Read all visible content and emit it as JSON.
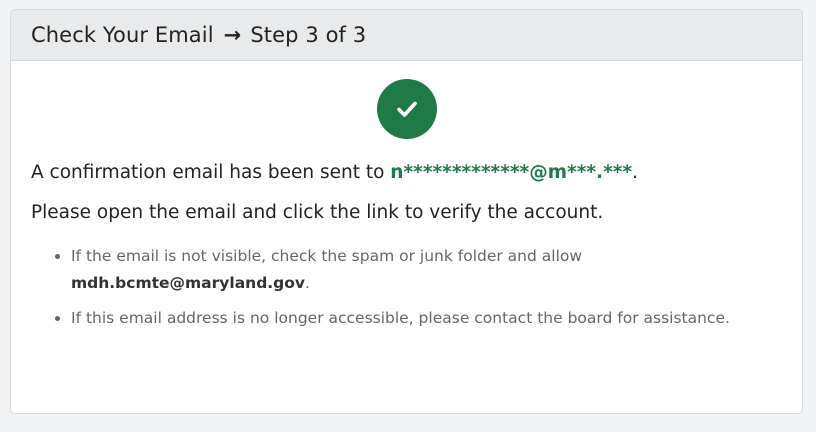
{
  "header": {
    "title": "Check Your Email",
    "arrow": "→",
    "step": "Step 3 of 3"
  },
  "confirmation": {
    "prefix": "A confirmation email has been sent to ",
    "masked_email": "n*************@m***.***",
    "suffix": ".",
    "instruction": "Please open the email and click the link to verify the account."
  },
  "notes": {
    "spam_prefix": "If the email is not visible, check the spam or junk folder and allow ",
    "sender_email": "mdh.bcmte@maryland.gov",
    "spam_suffix": ".",
    "access": "If this email address is no longer accessible, please contact the board for assistance."
  },
  "icons": {
    "success": "check-circle-icon"
  },
  "colors": {
    "accent": "#1f7a45",
    "header_bg": "#e9eaeb"
  }
}
